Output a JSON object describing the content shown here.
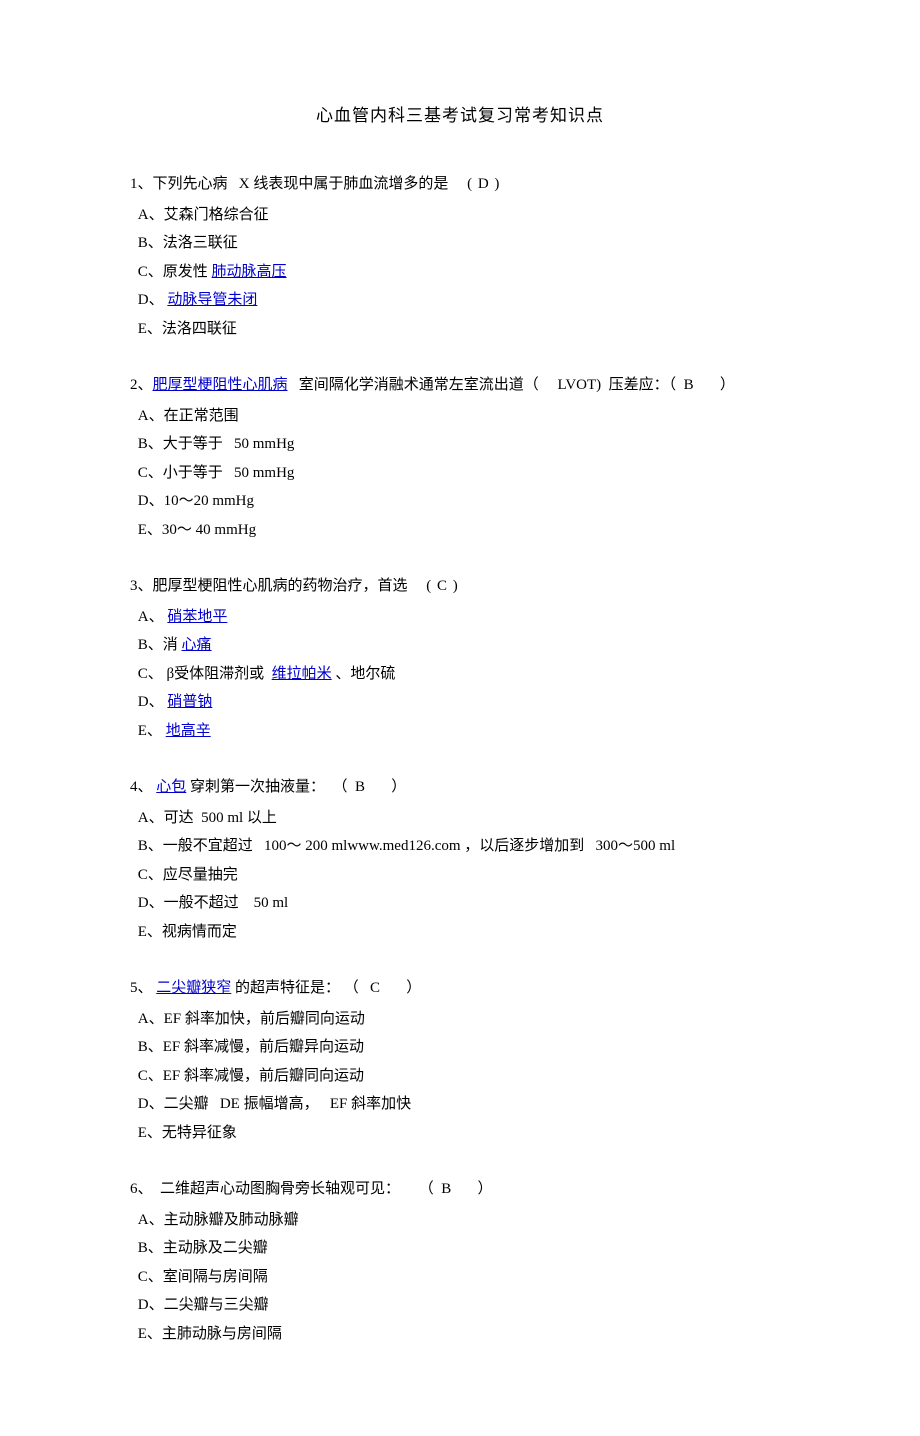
{
  "title": "心血管内科三基考试复习常考知识点",
  "questions": [
    {
      "num": "1",
      "stem_before": "、下列先心病   X 线表现中属于肺血流增多的是     ",
      "answer": "( D )",
      "options": [
        {
          "letter": "A",
          "parts": [
            {
              "t": "、艾森门格综合征"
            }
          ]
        },
        {
          "letter": "B",
          "parts": [
            {
              "t": "、法洛三联征"
            }
          ]
        },
        {
          "letter": "C",
          "parts": [
            {
              "t": "、原发性 "
            },
            {
              "t": "肺动脉高压",
              "link": true
            }
          ]
        },
        {
          "letter": "D",
          "parts": [
            {
              "t": "、 "
            },
            {
              "t": "动脉导管未闭",
              "link": true
            }
          ]
        },
        {
          "letter": "E",
          "parts": [
            {
              "t": "、法洛四联征"
            }
          ]
        }
      ]
    },
    {
      "num": "2",
      "stem_parts": [
        {
          "t": "、"
        },
        {
          "t": "肥厚型梗阻性心肌病",
          "link": true
        },
        {
          "t": "   室间隔化学消融术通常左室流出道（     LVOT)  压差应：（  B       ）"
        }
      ],
      "options": [
        {
          "letter": "A",
          "parts": [
            {
              "t": "、在正常范围"
            }
          ]
        },
        {
          "letter": "B",
          "parts": [
            {
              "t": "、大于等于   50 mmHg"
            }
          ]
        },
        {
          "letter": "C",
          "parts": [
            {
              "t": "、小于等于   50 mmHg"
            }
          ]
        },
        {
          "letter": "D",
          "parts": [
            {
              "t": "、10～20 mmHg"
            }
          ]
        },
        {
          "letter": "E",
          "parts": [
            {
              "t": "、30～ 40 mmHg"
            }
          ]
        }
      ]
    },
    {
      "num": "3",
      "stem_before": "、肥厚型梗阻性心肌病的药物治疗，首选     ",
      "answer": "( C )",
      "options": [
        {
          "letter": "A",
          "parts": [
            {
              "t": "、 "
            },
            {
              "t": "硝苯地平",
              "link": true
            }
          ]
        },
        {
          "letter": "B",
          "parts": [
            {
              "t": "、消 "
            },
            {
              "t": "心痛",
              "link": true
            }
          ]
        },
        {
          "letter": "C",
          "parts": [
            {
              "t": "、 β受体阻滞剂或  "
            },
            {
              "t": "维拉帕米",
              "link": true
            },
            {
              "t": " 、地尔硫"
            }
          ]
        },
        {
          "letter": "D",
          "parts": [
            {
              "t": "、 "
            },
            {
              "t": "硝普钠",
              "link": true
            }
          ]
        },
        {
          "letter": "E",
          "parts": [
            {
              "t": "、 "
            },
            {
              "t": "地高辛",
              "link": true
            }
          ]
        }
      ]
    },
    {
      "num": "4",
      "stem_parts": [
        {
          "t": "、 "
        },
        {
          "t": "心包",
          "link": true
        },
        {
          "t": " 穿刺第一次抽液量：  （  B       ）"
        }
      ],
      "options": [
        {
          "letter": "A",
          "parts": [
            {
              "t": "、可达  500 ml 以上"
            }
          ]
        },
        {
          "letter": "B",
          "parts": [
            {
              "t": "、一般不宜超过   100～ 200 mlwww.med126.com ，以后逐步增加到   300～500 ml"
            }
          ]
        },
        {
          "letter": "C",
          "parts": [
            {
              "t": "、应尽量抽完"
            }
          ]
        },
        {
          "letter": "D",
          "parts": [
            {
              "t": "、一般不超过    50 ml"
            }
          ]
        },
        {
          "letter": "E",
          "parts": [
            {
              "t": "、视病情而定"
            }
          ]
        }
      ]
    },
    {
      "num": "5",
      "stem_parts": [
        {
          "t": "、 "
        },
        {
          "t": "二尖瓣狭窄",
          "link": true
        },
        {
          "t": " 的超声特征是： （   C       ）"
        }
      ],
      "options": [
        {
          "letter": "A",
          "parts": [
            {
              "t": "、EF 斜率加快，前后瓣同向运动"
            }
          ]
        },
        {
          "letter": "B",
          "parts": [
            {
              "t": "、EF 斜率减慢，前后瓣异向运动"
            }
          ]
        },
        {
          "letter": "C",
          "parts": [
            {
              "t": "、EF 斜率减慢，前后瓣同向运动"
            }
          ]
        },
        {
          "letter": "D",
          "parts": [
            {
              "t": "、二尖瓣   DE 振幅增高，   EF 斜率加快"
            }
          ]
        },
        {
          "letter": "E",
          "parts": [
            {
              "t": "、无特异征象"
            }
          ]
        }
      ]
    },
    {
      "num": "6",
      "stem_before": "、  二维超声心动图胸骨旁长轴观可见：     （  B       ）",
      "answer": "",
      "options": [
        {
          "letter": "A",
          "parts": [
            {
              "t": "、主动脉瓣及肺动脉瓣"
            }
          ]
        },
        {
          "letter": "B",
          "parts": [
            {
              "t": "、主动脉及二尖瓣"
            }
          ]
        },
        {
          "letter": "C",
          "parts": [
            {
              "t": "、室间隔与房间隔"
            }
          ]
        },
        {
          "letter": "D",
          "parts": [
            {
              "t": "、二尖瓣与三尖瓣"
            }
          ]
        },
        {
          "letter": "E",
          "parts": [
            {
              "t": "、主肺动脉与房间隔"
            }
          ]
        }
      ]
    }
  ]
}
